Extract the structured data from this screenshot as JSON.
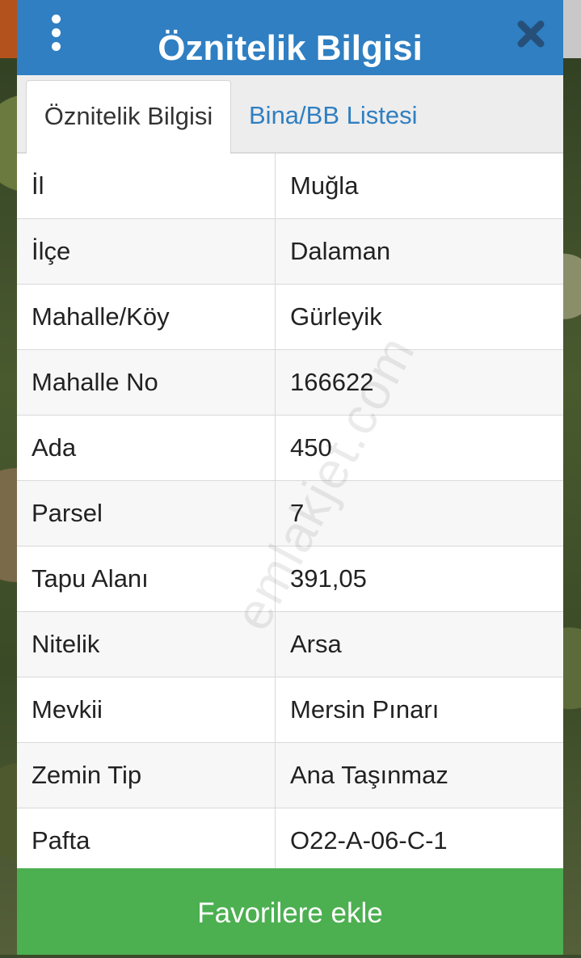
{
  "window": {
    "title": "Öznitelik Bilgisi"
  },
  "tabs": [
    {
      "label": "Öznitelik Bilgisi",
      "active": true
    },
    {
      "label": "Bina/BB Listesi",
      "active": false
    }
  ],
  "attributes": [
    {
      "key": "İl",
      "value": "Muğla"
    },
    {
      "key": "İlçe",
      "value": "Dalaman"
    },
    {
      "key": "Mahalle/Köy",
      "value": "Gürleyik"
    },
    {
      "key": "Mahalle No",
      "value": "166622"
    },
    {
      "key": "Ada",
      "value": "450"
    },
    {
      "key": "Parsel",
      "value": "7"
    },
    {
      "key": "Tapu Alanı",
      "value": "391,05"
    },
    {
      "key": "Nitelik",
      "value": "Arsa"
    },
    {
      "key": "Mevkii",
      "value": "Mersin Pınarı"
    },
    {
      "key": "Zemin Tip",
      "value": "Ana Taşınmaz"
    },
    {
      "key": "Pafta",
      "value": "O22-A-06-C-1"
    }
  ],
  "watermark": "emlakjet.com",
  "actions": {
    "favorite_label": "Favorilere ekle"
  },
  "colors": {
    "titlebar": "#2f7fc2",
    "accent_tab": "#2f7fc2",
    "favorite_button": "#4caf50"
  },
  "icons": {
    "menu": "more-vert-icon",
    "close": "close-icon"
  }
}
